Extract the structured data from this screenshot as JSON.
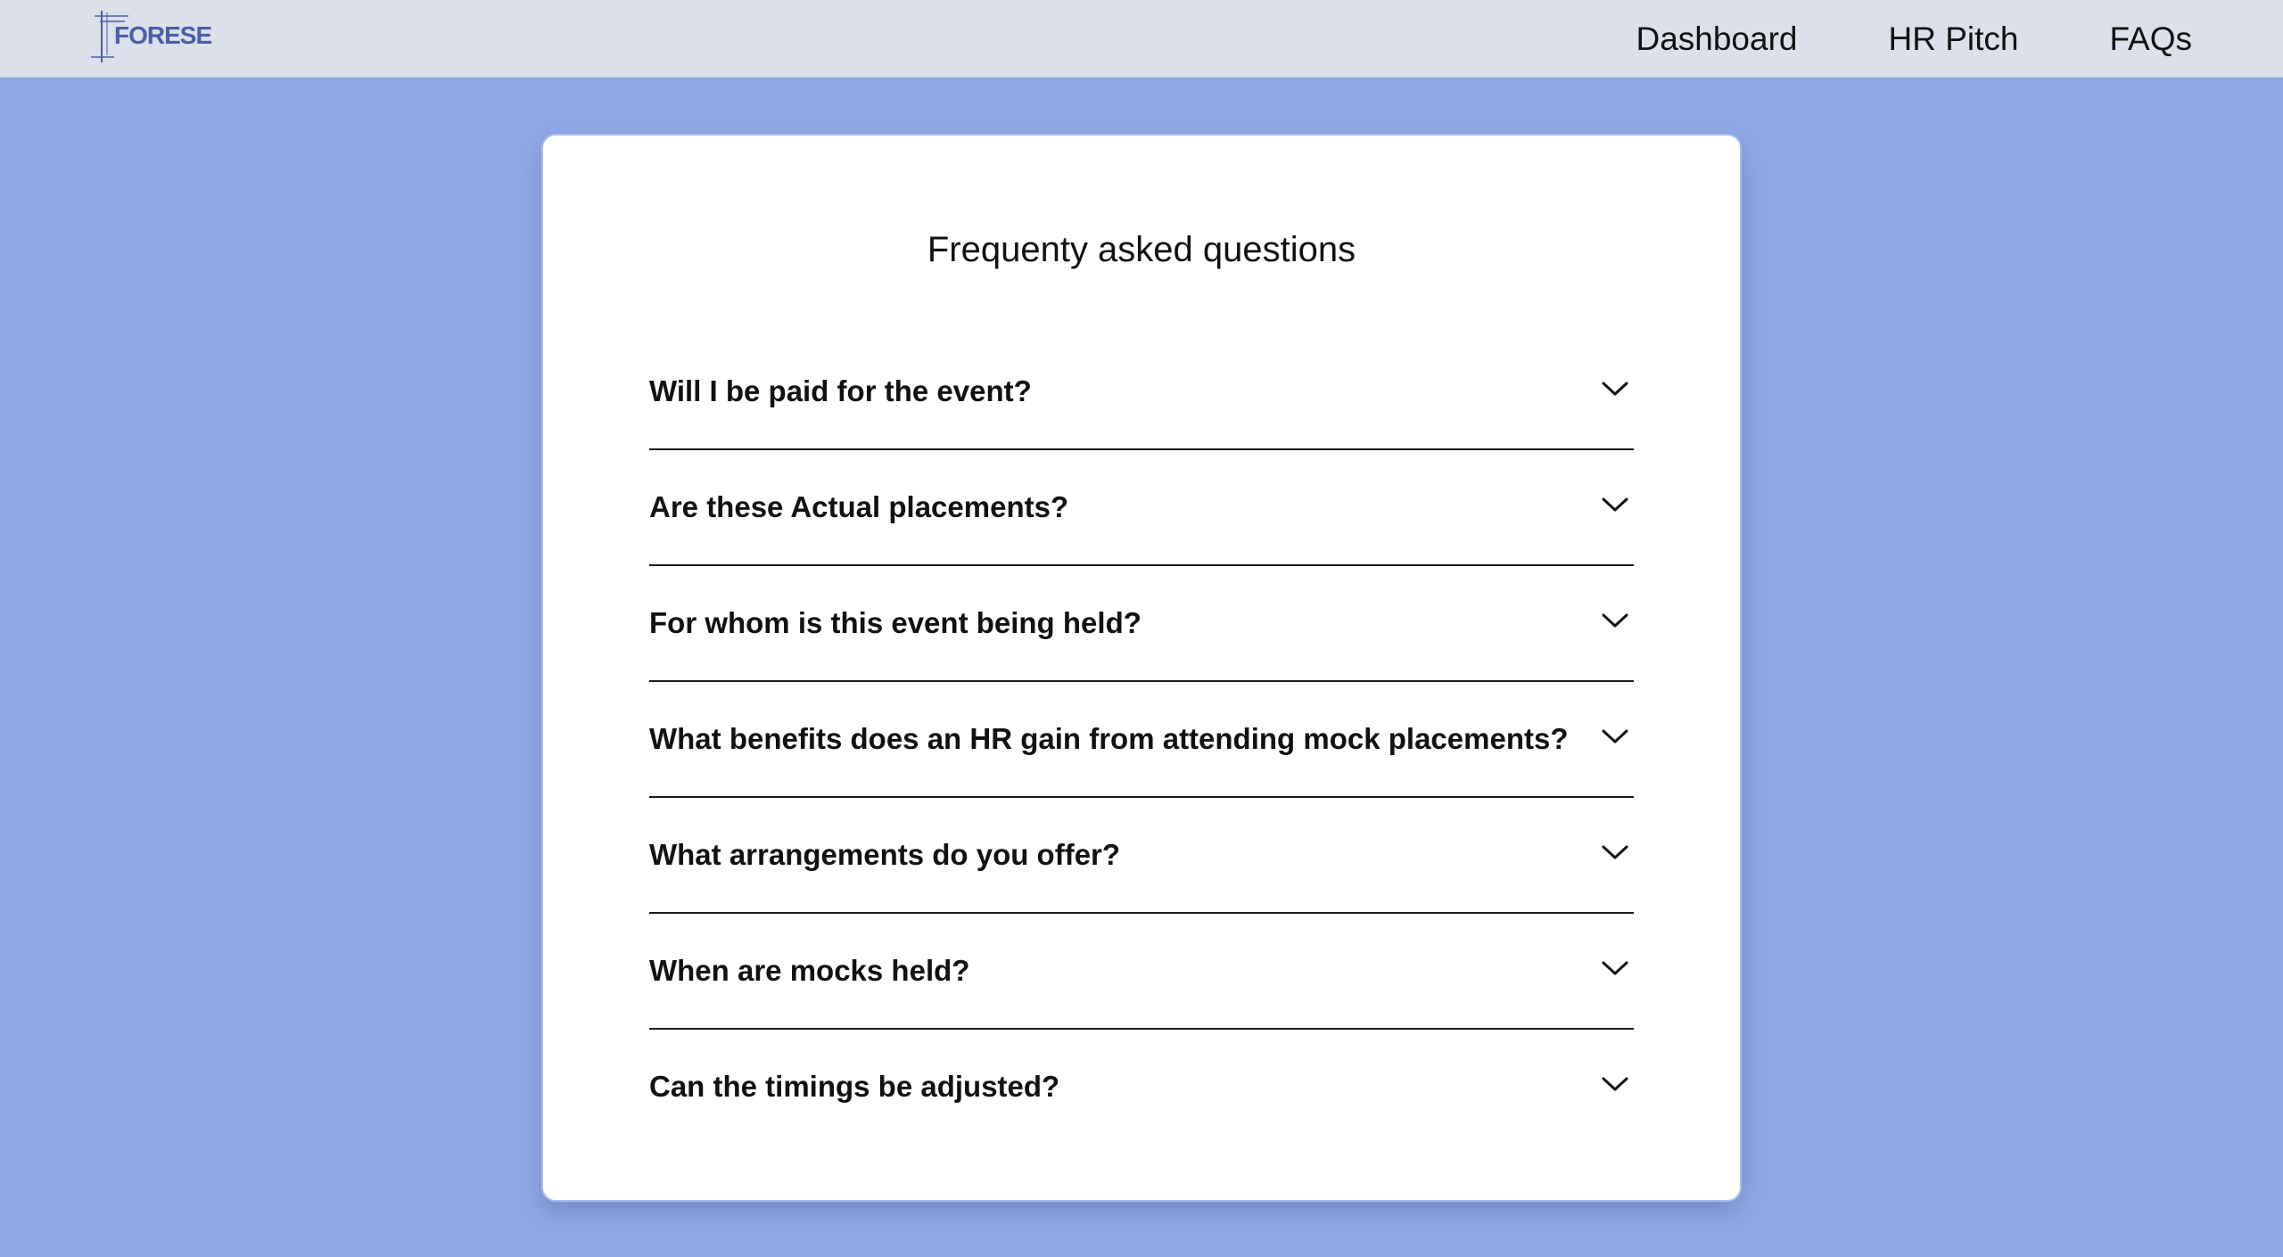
{
  "navbar": {
    "logo_text": "FORESE",
    "links": [
      {
        "label": "Dashboard"
      },
      {
        "label": "HR Pitch"
      },
      {
        "label": "FAQs"
      }
    ]
  },
  "faq": {
    "title": "Frequenty asked questions",
    "items": [
      {
        "question": "Will I be paid for the event?"
      },
      {
        "question": "Are these Actual placements?"
      },
      {
        "question": "For whom is this event being held?"
      },
      {
        "question": "What benefits does an HR gain from attending mock placements?"
      },
      {
        "question": "What arrangements do you offer?"
      },
      {
        "question": "When are mocks held?"
      },
      {
        "question": "Can the timings be adjusted?"
      }
    ]
  },
  "icons": {
    "expand": "chevron-down-icon"
  },
  "colors": {
    "background": "#8fa9e6",
    "navbar": "#dbe0ea",
    "card": "#ffffff",
    "logo": "#4a5ea8"
  }
}
